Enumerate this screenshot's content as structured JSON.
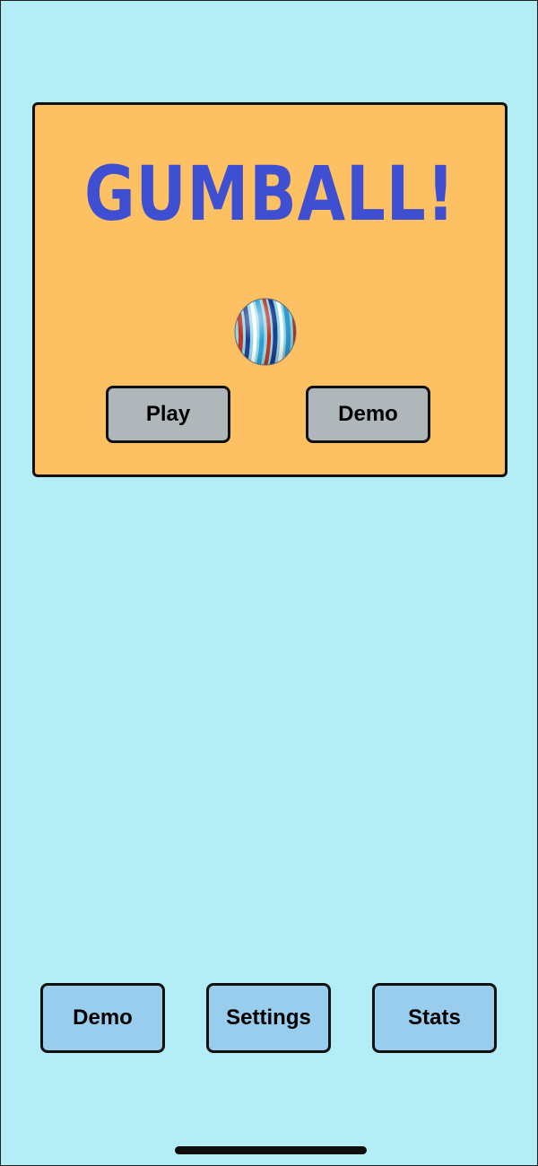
{
  "title": {
    "text": "GUMBALL!",
    "color": "#3f4fd2"
  },
  "marble": {
    "icon": "striped-marble-icon"
  },
  "panel": {
    "background": "#fdc063",
    "play_label": "Play",
    "demo_label": "Demo"
  },
  "bottom_bar": {
    "demo_label": "Demo",
    "settings_label": "Settings",
    "stats_label": "Stats"
  },
  "colors": {
    "screen_bg": "#b3edf6",
    "panel_button_bg": "#b0b7ba",
    "bottom_button_bg": "#99cdee"
  }
}
